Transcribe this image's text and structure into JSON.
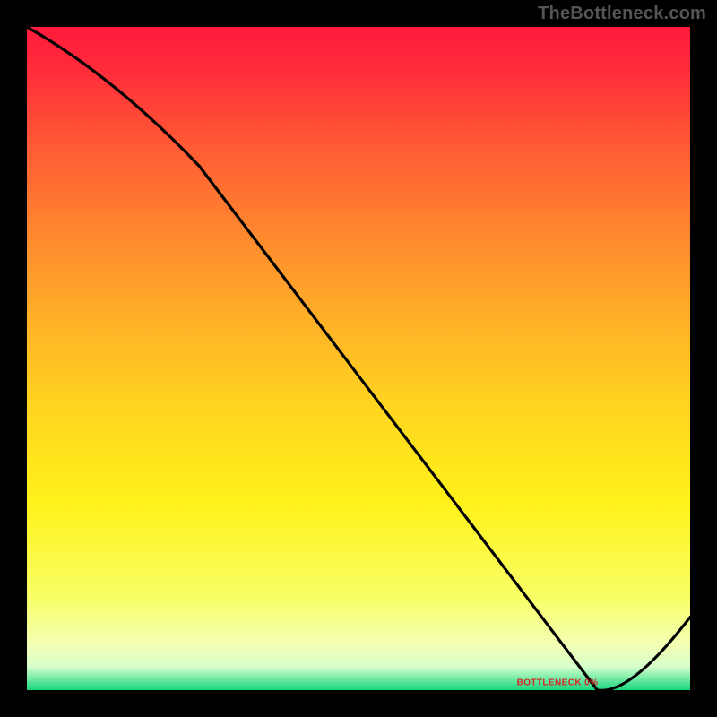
{
  "watermark": "TheBottleneck.com",
  "chart_data": {
    "type": "line",
    "title": "",
    "xlabel": "",
    "ylabel": "",
    "x": [
      0.0,
      0.26,
      0.86,
      1.0
    ],
    "values": [
      1.0,
      0.79,
      0.0,
      0.11
    ],
    "xlim": [
      0,
      1
    ],
    "ylim": [
      0,
      1
    ],
    "annotation": {
      "label": "BOTTLENECK 0%",
      "x": 0.8,
      "y": 0.005
    },
    "background_gradient": {
      "stops": [
        {
          "pos": 0.0,
          "color": "#ff1a3c"
        },
        {
          "pos": 0.06,
          "color": "#ff2a3a"
        },
        {
          "pos": 0.18,
          "color": "#ff5a34"
        },
        {
          "pos": 0.32,
          "color": "#ff8a2e"
        },
        {
          "pos": 0.45,
          "color": "#ffb327"
        },
        {
          "pos": 0.58,
          "color": "#ffd61f"
        },
        {
          "pos": 0.72,
          "color": "#fff21a"
        },
        {
          "pos": 0.86,
          "color": "#f8ff66"
        },
        {
          "pos": 0.93,
          "color": "#f4ffb3"
        },
        {
          "pos": 0.965,
          "color": "#d6ffca"
        },
        {
          "pos": 0.985,
          "color": "#66e8a1"
        },
        {
          "pos": 1.0,
          "color": "#17d67a"
        }
      ]
    }
  }
}
